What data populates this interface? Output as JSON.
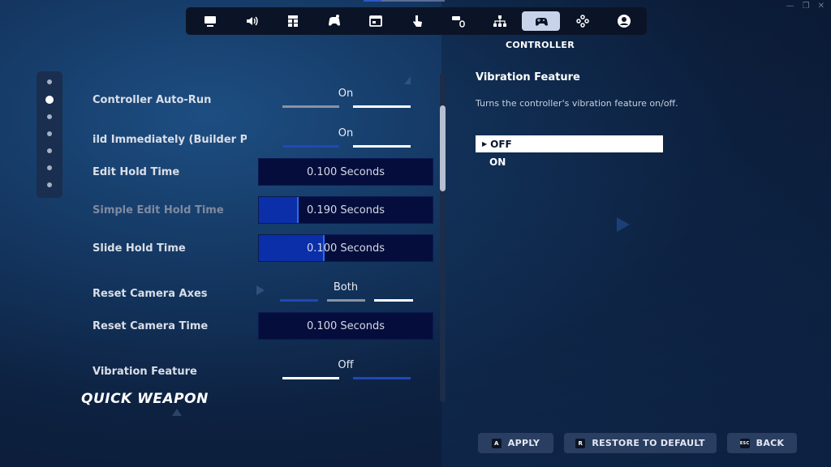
{
  "window_controls": {
    "minimize": "—",
    "restore": "❐",
    "close": "✕"
  },
  "top_nav": {
    "tabs": [
      {
        "icon": "monitor-icon",
        "active": false
      },
      {
        "icon": "speaker-icon",
        "active": false
      },
      {
        "icon": "accessibility-grid-icon",
        "active": false
      },
      {
        "icon": "gamepad-settings-icon",
        "active": false
      },
      {
        "icon": "window-icon",
        "active": false
      },
      {
        "icon": "touch-icon",
        "active": false
      },
      {
        "icon": "keyboard-mouse-icon",
        "active": false
      },
      {
        "icon": "network-icon",
        "active": false
      },
      {
        "icon": "controller-icon",
        "active": true
      },
      {
        "icon": "dpad-icon",
        "active": false
      },
      {
        "icon": "account-icon",
        "active": false
      }
    ],
    "active_label": "CONTROLLER"
  },
  "pager": {
    "count": 7,
    "active_index": 1
  },
  "settings": [
    {
      "label": "Controller Auto-Run",
      "type": "toggle",
      "value": "On"
    },
    {
      "label": "ild Immediately (Builder Pro)",
      "type": "toggle",
      "value": "On"
    },
    {
      "label": "Edit Hold Time",
      "type": "slider",
      "value": "0.100 Seconds",
      "level": 0
    },
    {
      "label": "Simple Edit Hold Time",
      "type": "slider",
      "value": "0.190 Seconds",
      "level": 0.23,
      "dim": true
    },
    {
      "label": "Slide Hold Time",
      "type": "slider",
      "value": "0.100 Seconds",
      "level": 0.38
    },
    {
      "label": "Reset Camera Axes",
      "type": "toggle3",
      "value": "Both"
    },
    {
      "label": "Reset Camera Time",
      "type": "slider",
      "value": "0.100 Seconds",
      "level": 0
    },
    {
      "label": "Vibration Feature",
      "type": "toggle",
      "value": "Off"
    }
  ],
  "section_heading": "QUICK WEAPON",
  "detail": {
    "title": "Vibration Feature",
    "description": "Turns the controller's vibration feature on/off.",
    "options": [
      {
        "label": "OFF",
        "selected": true
      },
      {
        "label": "ON",
        "selected": false
      }
    ]
  },
  "buttons": {
    "apply": {
      "key": "A",
      "label": "APPLY"
    },
    "restore": {
      "key": "R",
      "label": "RESTORE TO DEFAULT"
    },
    "back": {
      "key": "ESC",
      "label": "BACK"
    }
  },
  "colors": {
    "accent_blue": "#0b2fa8",
    "toggle_white": "#ffffff",
    "toggle_gray": "#8a93a3",
    "toggle_blue": "#1f49b8",
    "button_bg": "#2a3e62"
  }
}
